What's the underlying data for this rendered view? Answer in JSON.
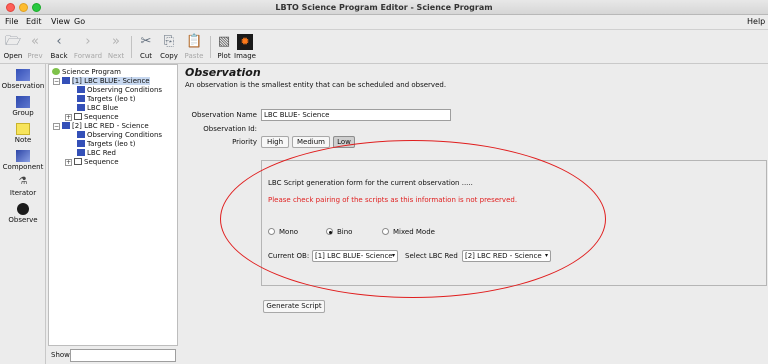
{
  "window": {
    "title": "LBTO Science Program Editor - Science Program"
  },
  "menubar": {
    "items": [
      "File",
      "Edit",
      "View",
      "Go"
    ],
    "help": "Help"
  },
  "toolbar": {
    "open": "Open",
    "prev": "Prev",
    "back": "Back",
    "forward": "Forward",
    "next": "Next",
    "cut": "Cut",
    "copy": "Copy",
    "paste": "Paste",
    "plot": "Plot",
    "image": "Image"
  },
  "palette": {
    "items": [
      "Observation",
      "Group",
      "Note",
      "Component",
      "Iterator",
      "Observe"
    ]
  },
  "tree": {
    "root": "Science Program",
    "obs1": "[1] LBC BLUE- Science",
    "obs1_children": [
      "Observing Conditions",
      "Targets (leo t)",
      "LBC Blue",
      "Sequence"
    ],
    "obs2": "[2] LBC RED - Science",
    "obs2_children": [
      "Observing Conditions",
      "Targets (leo t)",
      "LBC Red",
      "Sequence"
    ]
  },
  "show": {
    "label": "Show"
  },
  "main": {
    "title": "Observation",
    "desc": "An observation is the smallest entity that can be scheduled and observed.",
    "name_label": "Observation Name",
    "name_value": "LBC BLUE- Science",
    "id_label": "Observation Id:",
    "priority_label": "Priority",
    "priority": [
      "High",
      "Medium",
      "Low"
    ],
    "priority_selected": "Low"
  },
  "script_panel": {
    "heading": "LBC Script generation form for the current observation .....",
    "warning": "Please check pairing of the scripts as this information is not preserved.",
    "modes": [
      "Mono",
      "Bino",
      "Mixed Mode"
    ],
    "mode_selected": "Bino",
    "current_ob_label": "Current OB:",
    "current_ob_value": "[1] LBC BLUE- Science",
    "select_red_label": "Select LBC Red",
    "select_red_value": "[2] LBC RED - Science",
    "generate_button": "Generate Script"
  },
  "colors": {
    "annotation": "#e01e1e",
    "warning": "#e02020",
    "selection": "#c7d8f0"
  }
}
